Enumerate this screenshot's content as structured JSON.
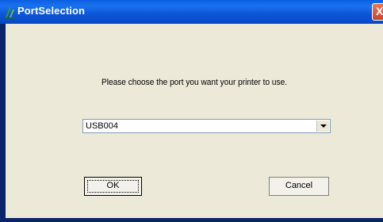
{
  "window": {
    "title": "PortSelection",
    "close_glyph": "X",
    "icon": "printer-app-icon"
  },
  "dialog": {
    "prompt": "Please choose the port you want your printer to use.",
    "port_select": {
      "value": "USB004"
    },
    "ok_label": "OK",
    "cancel_label": "Cancel"
  },
  "colors": {
    "titlebar": "#0d55d8",
    "dialog_bg": "#ece9d8",
    "close_button": "#c9452a"
  }
}
